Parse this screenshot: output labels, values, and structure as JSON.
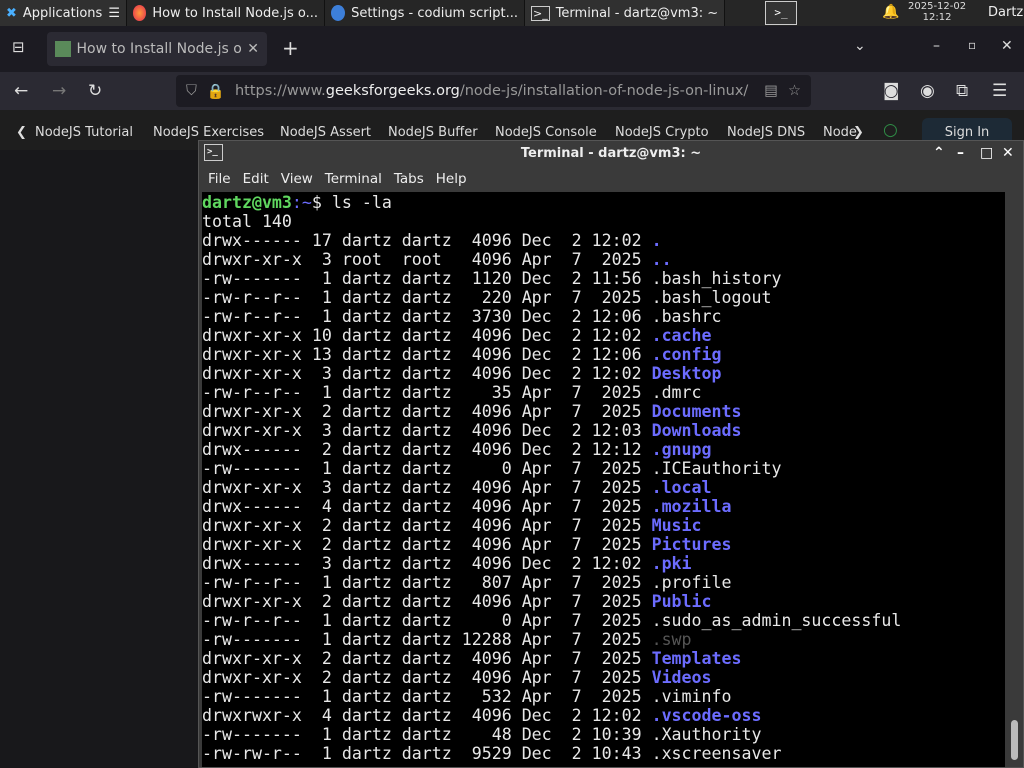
{
  "panel": {
    "applications": "Applications",
    "tasks": [
      "How to Install Node.js o...",
      "Settings - codium script...",
      "Terminal - dartz@vm3: ~"
    ],
    "date": "2025-12-02",
    "time": "12:12",
    "user": "Dartz"
  },
  "browser": {
    "tab_title": "How to Install Node.js or",
    "url_prefix": "https://www.",
    "url_domain": "geeksforgeeks.org",
    "url_path": "/node-js/installation-of-node-js-on-linux/",
    "bookmarks": [
      "NodeJS Tutorial",
      "NodeJS Exercises",
      "NodeJS Assert",
      "NodeJS Buffer",
      "NodeJS Console",
      "NodeJS Crypto",
      "NodeJS DNS",
      "Node"
    ],
    "sign_in": "Sign In"
  },
  "terminal": {
    "title": "Terminal - dartz@vm3: ~",
    "menu": [
      "File",
      "Edit",
      "View",
      "Terminal",
      "Tabs",
      "Help"
    ],
    "prompt_user": "dartz@vm3",
    "prompt_path": ":~",
    "prompt_sym": "$ ",
    "command": "ls -la",
    "total": "total 140",
    "rows": [
      {
        "meta": "drwx------ 17 dartz dartz  4096 Dec  2 12:02 ",
        "name": ".",
        "kind": "dir"
      },
      {
        "meta": "drwxr-xr-x  3 root  root   4096 Apr  7  2025 ",
        "name": "..",
        "kind": "dir"
      },
      {
        "meta": "-rw-------  1 dartz dartz  1120 Dec  2 11:56 ",
        "name": ".bash_history",
        "kind": "file"
      },
      {
        "meta": "-rw-r--r--  1 dartz dartz   220 Apr  7  2025 ",
        "name": ".bash_logout",
        "kind": "file"
      },
      {
        "meta": "-rw-r--r--  1 dartz dartz  3730 Dec  2 12:06 ",
        "name": ".bashrc",
        "kind": "file"
      },
      {
        "meta": "drwxr-xr-x 10 dartz dartz  4096 Dec  2 12:02 ",
        "name": ".cache",
        "kind": "dir"
      },
      {
        "meta": "drwxr-xr-x 13 dartz dartz  4096 Dec  2 12:06 ",
        "name": ".config",
        "kind": "dir"
      },
      {
        "meta": "drwxr-xr-x  3 dartz dartz  4096 Dec  2 12:02 ",
        "name": "Desktop",
        "kind": "dir"
      },
      {
        "meta": "-rw-r--r--  1 dartz dartz    35 Apr  7  2025 ",
        "name": ".dmrc",
        "kind": "file"
      },
      {
        "meta": "drwxr-xr-x  2 dartz dartz  4096 Apr  7  2025 ",
        "name": "Documents",
        "kind": "dir"
      },
      {
        "meta": "drwxr-xr-x  3 dartz dartz  4096 Dec  2 12:03 ",
        "name": "Downloads",
        "kind": "dir"
      },
      {
        "meta": "drwx------  2 dartz dartz  4096 Dec  2 12:12 ",
        "name": ".gnupg",
        "kind": "dir"
      },
      {
        "meta": "-rw-------  1 dartz dartz     0 Apr  7  2025 ",
        "name": ".ICEauthority",
        "kind": "file"
      },
      {
        "meta": "drwxr-xr-x  3 dartz dartz  4096 Apr  7  2025 ",
        "name": ".local",
        "kind": "dir"
      },
      {
        "meta": "drwx------  4 dartz dartz  4096 Apr  7  2025 ",
        "name": ".mozilla",
        "kind": "dir"
      },
      {
        "meta": "drwxr-xr-x  2 dartz dartz  4096 Apr  7  2025 ",
        "name": "Music",
        "kind": "dir"
      },
      {
        "meta": "drwxr-xr-x  2 dartz dartz  4096 Apr  7  2025 ",
        "name": "Pictures",
        "kind": "dir"
      },
      {
        "meta": "drwx------  3 dartz dartz  4096 Dec  2 12:02 ",
        "name": ".pki",
        "kind": "dir"
      },
      {
        "meta": "-rw-r--r--  1 dartz dartz   807 Apr  7  2025 ",
        "name": ".profile",
        "kind": "file"
      },
      {
        "meta": "drwxr-xr-x  2 dartz dartz  4096 Apr  7  2025 ",
        "name": "Public",
        "kind": "dir"
      },
      {
        "meta": "-rw-r--r--  1 dartz dartz     0 Apr  7  2025 ",
        "name": ".sudo_as_admin_successful",
        "kind": "file"
      },
      {
        "meta": "-rw-------  1 dartz dartz 12288 Apr  7  2025 ",
        "name": ".swp",
        "kind": "dim"
      },
      {
        "meta": "drwxr-xr-x  2 dartz dartz  4096 Apr  7  2025 ",
        "name": "Templates",
        "kind": "dir"
      },
      {
        "meta": "drwxr-xr-x  2 dartz dartz  4096 Apr  7  2025 ",
        "name": "Videos",
        "kind": "dir"
      },
      {
        "meta": "-rw-------  1 dartz dartz   532 Apr  7  2025 ",
        "name": ".viminfo",
        "kind": "file"
      },
      {
        "meta": "drwxrwxr-x  4 dartz dartz  4096 Dec  2 12:02 ",
        "name": ".vscode-oss",
        "kind": "dir"
      },
      {
        "meta": "-rw-------  1 dartz dartz    48 Dec  2 10:39 ",
        "name": ".Xauthority",
        "kind": "file"
      },
      {
        "meta": "-rw-rw-r--  1 dartz dartz  9529 Dec  2 10:43 ",
        "name": ".xscreensaver",
        "kind": "file"
      }
    ]
  },
  "colors": {
    "dir": "#6c6cff",
    "prompt": "#5fd75f"
  }
}
